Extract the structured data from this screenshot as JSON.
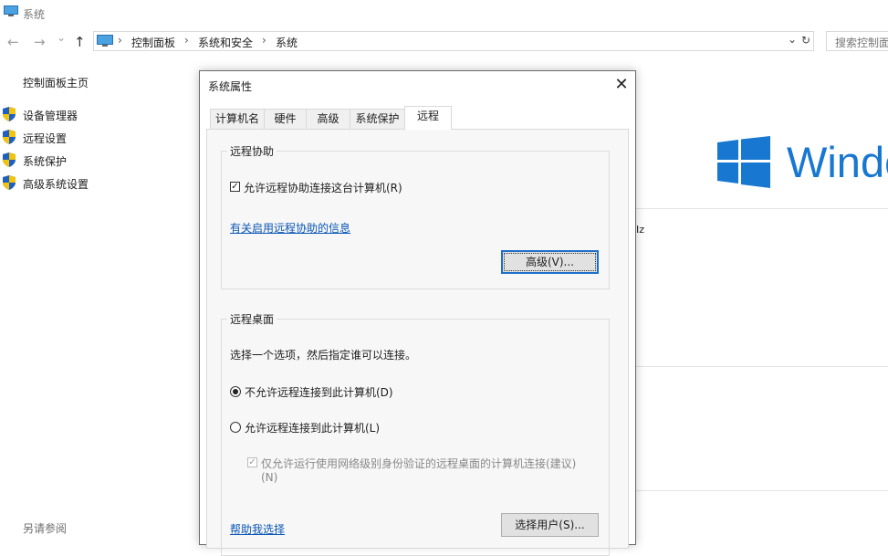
{
  "window": {
    "title": "系统"
  },
  "nav": {
    "back_glyph": "←",
    "forward_glyph": "→",
    "dropdown_glyph": "⌄",
    "up_glyph": "↑",
    "breadcrumbs": [
      "控制面板",
      "系统和安全",
      "系统"
    ],
    "separator": "›",
    "addr_dropdown_glyph": "⌄",
    "refresh_glyph": "↻",
    "search_placeholder": "搜索控制面"
  },
  "left_pane": {
    "home": "控制面板主页",
    "links": [
      "设备管理器",
      "远程设置",
      "系统保护",
      "高级系统设置"
    ],
    "see_also": "另请参阅"
  },
  "background": {
    "windows_text": "Windo",
    "partial_text": "Iz"
  },
  "dialog": {
    "title": "系统属性",
    "close_glyph": "✕",
    "tabs": [
      "计算机名",
      "硬件",
      "高级",
      "系统保护",
      "远程"
    ],
    "active_tab": "远程",
    "remote_assistance": {
      "group_label": "远程协助",
      "allow_checkbox_label": "允许远程协助连接这台计算机(R)",
      "allow_checked": true,
      "info_link": "有关启用远程协助的信息",
      "advanced_button": "高级(V)..."
    },
    "remote_desktop": {
      "group_label": "远程桌面",
      "description": "选择一个选项，然后指定谁可以连接。",
      "option_disallow": "不允许远程连接到此计算机(D)",
      "option_allow": "允许远程连接到此计算机(L)",
      "selected_option": "不允许远程连接到此计算机(D)",
      "nla_label_line1": "仅允许运行使用网络级别身份验证的远程桌面的计算机连接(建议)",
      "nla_label_line2": "(N)",
      "nla_checked": true,
      "help_link": "帮助我选择",
      "select_users_button": "选择用户(S)..."
    }
  },
  "colors": {
    "accent_blue": "#1777d1",
    "link_blue": "#0b57b5",
    "shield_blue": "#1f5fbf",
    "shield_yellow": "#f2c40f"
  }
}
